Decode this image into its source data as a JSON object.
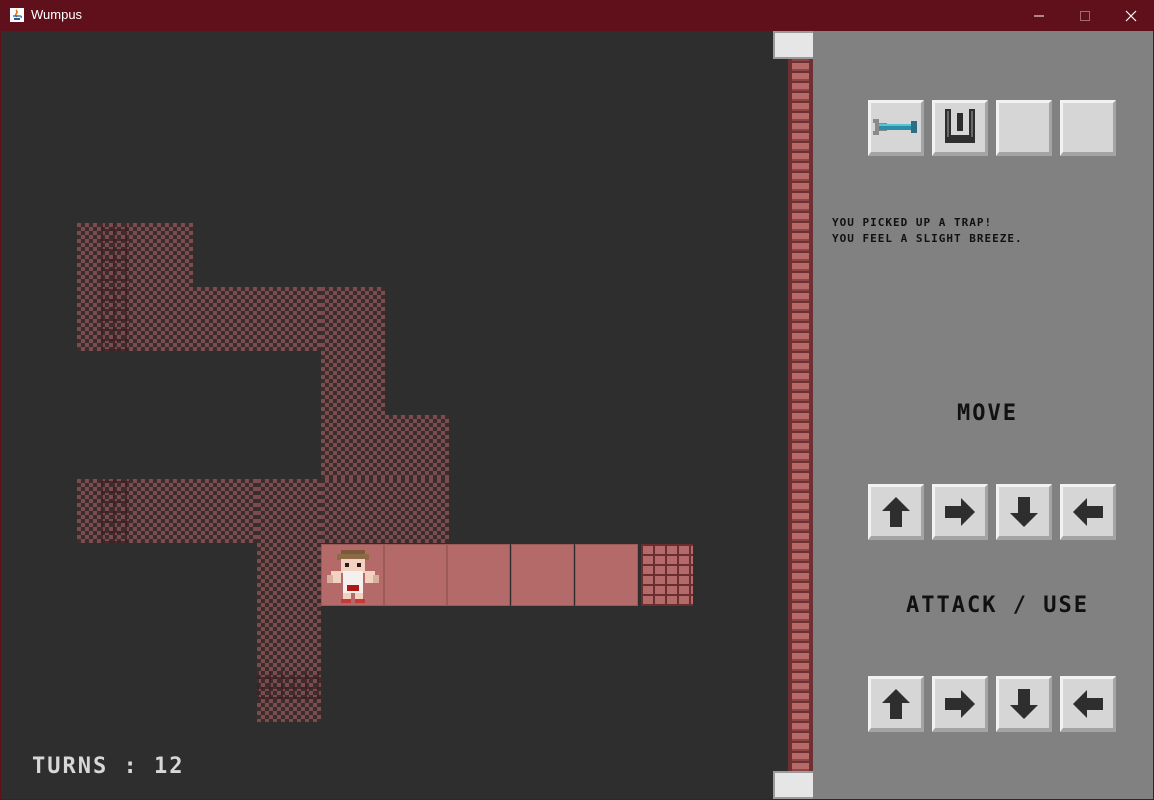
{
  "window": {
    "title": "Wumpus",
    "controls": {
      "minimize": "minimize-icon",
      "maximize": "maximize-icon",
      "close": "close-icon"
    }
  },
  "game": {
    "turns_label": "TURNS : 12",
    "player": "player-character"
  },
  "inventory": [
    {
      "name": "arrow",
      "icon": "arrow-icon",
      "filled": true
    },
    {
      "name": "trap",
      "icon": "trap-icon",
      "filled": true
    },
    {
      "name": "empty",
      "icon": "",
      "filled": false
    },
    {
      "name": "empty",
      "icon": "",
      "filled": false
    }
  ],
  "messages": [
    "YOU PICKED UP A TRAP!",
    "YOU FEEL A SLIGHT BREEZE."
  ],
  "move_section": {
    "label": "MOVE"
  },
  "attack_section": {
    "label": "ATTACK / USE"
  },
  "directions": [
    "up",
    "right",
    "down",
    "left"
  ],
  "colors": {
    "titlebar": "#5f101a",
    "background": "#2e2e2e",
    "panel": "#818181",
    "room": "#b36a69",
    "slot": "#d6d6d6"
  }
}
